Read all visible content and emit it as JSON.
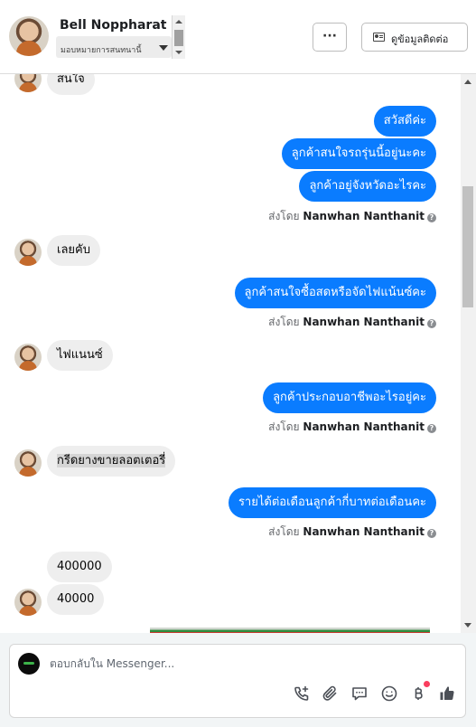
{
  "header": {
    "contact_name": "Bell Noppharat",
    "assign_label": "มอบหมายการสนทนานี้",
    "more_label": "···",
    "view_contact_label": "ดูข้อมูลติดต่อ"
  },
  "messages": {
    "partial_top": "สนใจ",
    "out_1": "สวัสดีค่ะ",
    "out_2": "ลูกค้าสนใจรถรุ่นนี้อยู่นะคะ",
    "out_3": "ลูกค้าอยู่จังหวัดอะไรคะ",
    "in_1": "เลยคับ",
    "out_4": "ลูกค้าสนใจซื้อสดหรือจัดไฟแน้นซ์คะ",
    "in_2": "ไฟแนนซ์",
    "out_5": "ลูกค้าประกอบอาชีพอะไรอยู่คะ",
    "in_3": "กรีดยางขายลอตเตอรี่",
    "out_6": "รายได้ต่อเดือนลูกค้ากี่บาทต่อเดือนคะ",
    "in_4": "400000",
    "in_5": "40000"
  },
  "sent_by": {
    "prefix": "ส่งโดย",
    "agent": "Nanwhan Nanthanit",
    "help": "?"
  },
  "composer": {
    "placeholder": "ตอบกลับใน Messenger..."
  },
  "colors": {
    "outgoing_bubble": "#0a7cff",
    "incoming_bubble": "#eeeeee",
    "icon": "#4b4f56"
  },
  "icons": [
    "phone-plus-icon",
    "paperclip-icon",
    "saved-reply-icon",
    "emoji-icon",
    "baht-payment-icon",
    "thumbs-up-icon"
  ]
}
